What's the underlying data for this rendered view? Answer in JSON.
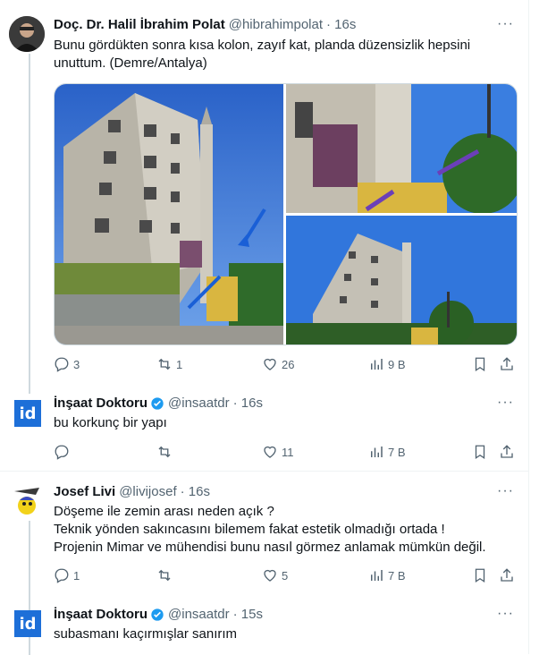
{
  "tweets": [
    {
      "name": "Doç. Dr. Halil İbrahim Polat",
      "handle": "@hibrahimpolat",
      "time": "· 16s",
      "text1": "Bunu gördükten sonra kısa kolon, zayıf kat, planda düzensizlik hepsini",
      "text2": "unuttum. (Demre/Antalya)",
      "replies": "3",
      "retweets": "1",
      "likes": "26",
      "views": "9 B"
    },
    {
      "name": "İnşaat Doktoru",
      "handle": "@insaatdr",
      "time": "· 16s",
      "text1": "bu korkunç bir yapı",
      "replies": "",
      "retweets": "",
      "likes": "11",
      "views": "7 B"
    },
    {
      "name": "Josef Livi",
      "handle": "@livijosef",
      "time": "· 16s",
      "text1": "Döşeme ile zemin arası neden açık ?",
      "text2": "Teknik yönden sakıncasını bilemem fakat estetik olmadığı ortada !",
      "text3": "Projenin Mimar ve mühendisi bunu nasıl görmez anlamak mümkün değil.",
      "replies": "1",
      "retweets": "",
      "likes": "5",
      "views": "7 B"
    },
    {
      "name": "İnşaat Doktoru",
      "handle": "@insaatdr",
      "time": "· 15s",
      "text1": "subasmanı kaçırmışlar sanırım"
    }
  ],
  "avatar_letters": "id",
  "colors": {
    "accent": "#1d9bf0",
    "muted": "#536471",
    "divider": "#eff3f4"
  }
}
